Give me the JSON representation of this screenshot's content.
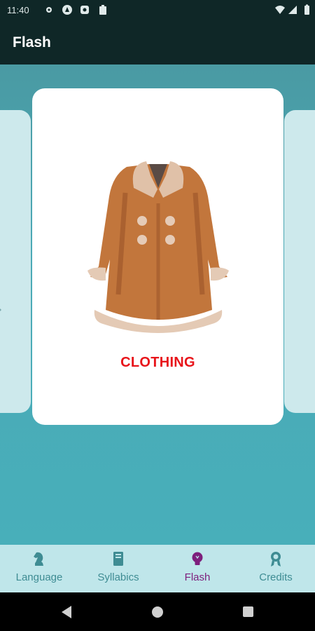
{
  "status_bar": {
    "time": "11:40"
  },
  "app_bar": {
    "title": "Flash"
  },
  "flash_card": {
    "label": "CLOTHING"
  },
  "bottom_nav": {
    "items": [
      {
        "label": "Language",
        "icon": "chess-knight-icon",
        "active": false
      },
      {
        "label": "Syllabics",
        "icon": "book-icon",
        "active": false
      },
      {
        "label": "Flash",
        "icon": "lightbulb-icon",
        "active": true
      },
      {
        "label": "Credits",
        "icon": "award-ribbon-icon",
        "active": false
      }
    ]
  },
  "colors": {
    "app_bar": "#0f2727",
    "content_bg": "#48afba",
    "card_label": "#e8141a",
    "nav_bg": "#bfe6ea",
    "nav_inactive": "#3e8c93",
    "nav_active": "#7d1f7c"
  }
}
